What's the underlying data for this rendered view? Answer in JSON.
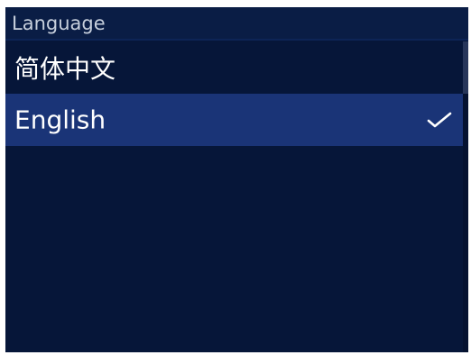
{
  "header": {
    "title": "Language"
  },
  "languages": [
    {
      "label": "简体中文",
      "selected": false
    },
    {
      "label": "English",
      "selected": true
    }
  ],
  "icons": {
    "selected_marker": "check-icon"
  },
  "colors": {
    "background": "#061639",
    "selected_row": "#1a3477",
    "header_bg": "#0a1d45",
    "text": "#ffffff"
  }
}
